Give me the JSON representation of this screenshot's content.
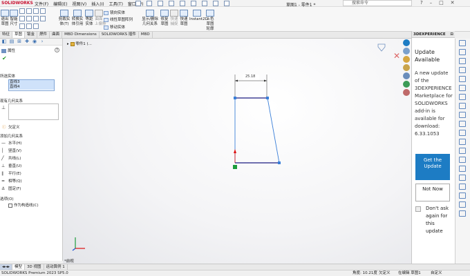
{
  "app": {
    "brand": "SOLIDWORKS",
    "menu": [
      "文件(F)",
      "编辑(E)",
      "视图(V)",
      "插入(I)",
      "工具(T)",
      "窗口(W)"
    ],
    "document_title": "草图1 - 零件1 *",
    "search_placeholder": "搜索命令"
  },
  "ribbon": {
    "big_buttons": [
      {
        "label": "退出\n草图"
      },
      {
        "label": "智能\n尺寸"
      },
      {
        "label": "剪裁实\n体(T)"
      },
      {
        "label": "转换实\n体引用"
      },
      {
        "label": "等距\n实体"
      },
      {
        "label": "曲面\n上偏移"
      },
      {
        "label": "显示/删除\n几何关系"
      },
      {
        "label": "修复\n草图"
      },
      {
        "label": "快速\n捕捉"
      },
      {
        "label": "快速\n草图"
      },
      {
        "label": "Instant2D"
      },
      {
        "label": "上色\n草图\n轮廓"
      }
    ],
    "small_buttons": [
      "镜向实体",
      "线性草图阵列",
      "移动实体"
    ]
  },
  "tabs": [
    "特征",
    "草图",
    "钣金",
    "焊件",
    "曲面",
    "MBD Dimensions",
    "SOLIDWORKS 插件",
    "MBD"
  ],
  "left_panel": {
    "title": "属性",
    "selected_label": "所选实体",
    "selected_items": [
      "直线3",
      "直线4"
    ],
    "existing_rel_label": "现有几何关系",
    "undefined_label": "欠定义",
    "add_rel_label": "添加几何关系",
    "relations": [
      "水平(H)",
      "竖直(V)",
      "共线(L)",
      "垂直(U)",
      "平行(E)",
      "相等(Q)",
      "固定(F)"
    ],
    "options_label": "选项(O)",
    "construction_label": "作为构造线(C)"
  },
  "canvas": {
    "tree_label": "零件1 (...",
    "dimension_text": "25.18",
    "view_label": "*前视"
  },
  "right_panel": {
    "header": "3DEXPERIENCE",
    "title": "Update Available",
    "body": "A new update of the 3DEXPERIENCE Marketplace for SOLIDWORKS add-in is available for download: 6.33.1053",
    "get_update": "Get the Update",
    "not_now": "Not Now",
    "dont_ask": "Don't ask again for this update"
  },
  "bottom_tabs": [
    "模型",
    "3D 视图",
    "运动算例 1"
  ],
  "status": {
    "left": "SOLIDWORKS Premium 2023 SP5.0",
    "angle": "角度: 10.21度",
    "state": "欠定义",
    "editing": "在编辑 草图1",
    "custom": "自定义"
  },
  "colors": {
    "accent": "#1d7cc4",
    "sketch_blue": "#3a7fd8",
    "selected": "#1a1a80"
  }
}
